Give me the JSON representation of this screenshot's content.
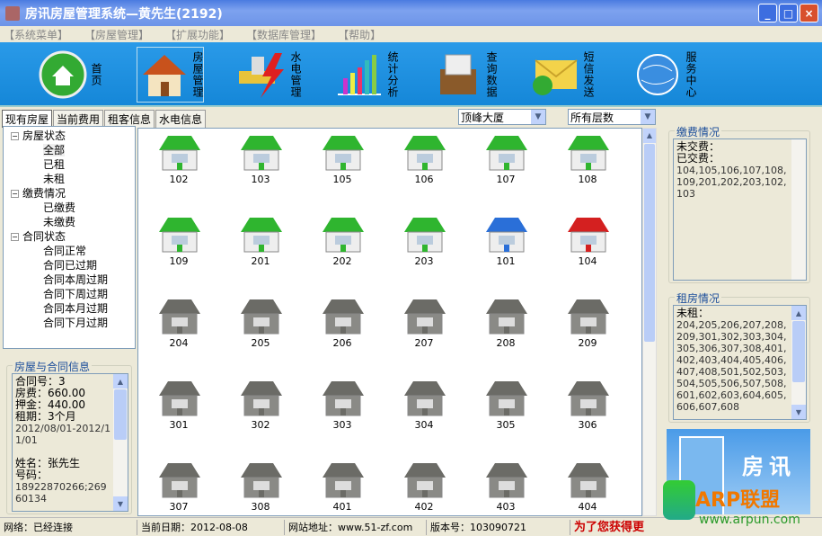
{
  "window": {
    "title": "房讯房屋管理系统—黄先生(2192)",
    "buttons": [
      "_",
      "□",
      "×"
    ]
  },
  "menu": [
    "【系统菜单】",
    "【房屋管理】",
    "【扩展功能】",
    "【数据库管理】",
    "【帮助】"
  ],
  "toolbar": [
    {
      "label": "首页",
      "icon": "home-icon"
    },
    {
      "label": "房屋管理",
      "icon": "house-icon",
      "selected": true
    },
    {
      "label": "水电管理",
      "icon": "utility-icon"
    },
    {
      "label": "统计分析",
      "icon": "chart-icon"
    },
    {
      "label": "查询数据",
      "icon": "files-icon"
    },
    {
      "label": "短信发送",
      "icon": "envelope-icon"
    },
    {
      "label": "服务中心",
      "icon": "globe-icon"
    }
  ],
  "tabs": [
    "现有房屋",
    "当前费用",
    "租客信息",
    "水电信息"
  ],
  "filters": {
    "building": "顶峰大厦",
    "floor": "所有层数"
  },
  "tree": [
    {
      "label": "房屋状态",
      "children": [
        "全部",
        "已租",
        "未租"
      ]
    },
    {
      "label": "缴费情况",
      "children": [
        "已缴费",
        "未缴费"
      ]
    },
    {
      "label": "合同状态",
      "children": [
        "合同正常",
        "合同已过期",
        "合同本周过期",
        "合同下周过期",
        "合同本月过期",
        "合同下月过期"
      ]
    }
  ],
  "contract": {
    "title": "房屋与合同信息",
    "lines": [
      "合同号：3",
      "房费：660.00",
      "押金：440.00",
      "租期：3个月"
    ],
    "period": "2012/08/01-2012/11/01",
    "name": "姓名：张先生",
    "phone_label": "号码：",
    "phone": "18922870266;26960134"
  },
  "rooms": [
    {
      "no": "102",
      "status": "green"
    },
    {
      "no": "103",
      "status": "green"
    },
    {
      "no": "105",
      "status": "green"
    },
    {
      "no": "106",
      "status": "green"
    },
    {
      "no": "107",
      "status": "green"
    },
    {
      "no": "108",
      "status": "green"
    },
    {
      "no": "109",
      "status": "green"
    },
    {
      "no": "201",
      "status": "green"
    },
    {
      "no": "202",
      "status": "green"
    },
    {
      "no": "203",
      "status": "green"
    },
    {
      "no": "101",
      "status": "blue"
    },
    {
      "no": "104",
      "status": "red"
    },
    {
      "no": "204",
      "status": "gray"
    },
    {
      "no": "205",
      "status": "gray"
    },
    {
      "no": "206",
      "status": "gray"
    },
    {
      "no": "207",
      "status": "gray"
    },
    {
      "no": "208",
      "status": "gray"
    },
    {
      "no": "209",
      "status": "gray"
    },
    {
      "no": "301",
      "status": "gray"
    },
    {
      "no": "302",
      "status": "gray"
    },
    {
      "no": "303",
      "status": "gray"
    },
    {
      "no": "304",
      "status": "gray"
    },
    {
      "no": "305",
      "status": "gray"
    },
    {
      "no": "306",
      "status": "gray"
    },
    {
      "no": "307",
      "status": "gray"
    },
    {
      "no": "308",
      "status": "gray"
    },
    {
      "no": "401",
      "status": "gray"
    },
    {
      "no": "402",
      "status": "gray"
    },
    {
      "no": "403",
      "status": "gray"
    },
    {
      "no": "404",
      "status": "gray"
    }
  ],
  "colors": {
    "green": "#2fb52f",
    "blue": "#2a6fd8",
    "red": "#d42020",
    "gray": "#6b6b66"
  },
  "payment": {
    "title": "缴费情况",
    "unpaid": "未交费：",
    "paid": "已交费：",
    "paid_list": "104,105,106,107,108,109,201,202,203,102,103"
  },
  "rental": {
    "title": "租房情况",
    "unrented": "未租：",
    "list": "204,205,206,207,208,209,301,302,303,304,305,306,307,308,401,402,403,404,405,406,407,408,501,502,503,504,505,506,507,508,601,602,603,604,605,606,607,608"
  },
  "banner": {
    "text": "房讯"
  },
  "status": {
    "network": "网络：已经连接",
    "date": "当前日期：2012-08-08",
    "site": "网站地址：www.51-zf.com",
    "version": "版本号：103090721",
    "notice": "为了您获得更"
  },
  "watermark": {
    "logo": "ARP联盟",
    "url": "www.arpun.com"
  }
}
